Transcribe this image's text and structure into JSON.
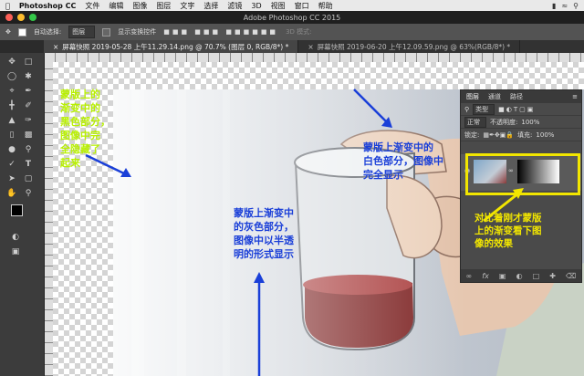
{
  "menubar": {
    "app": "Photoshop CC",
    "items": [
      "文件",
      "编辑",
      "图像",
      "图层",
      "文字",
      "选择",
      "滤镜",
      "3D",
      "视图",
      "窗口",
      "帮助"
    ]
  },
  "window": {
    "title": "Adobe Photoshop CC 2015"
  },
  "options": {
    "auto_select_label": "自动选择:",
    "auto_select_value": "图层",
    "transform_label": "显示变换控件",
    "mode_3d": "3D 模式:"
  },
  "tabs": [
    {
      "label": "屏幕快照 2019-05-28 上午11.29.14.png @ 70.7% (图层 0, RGB/8*) *"
    },
    {
      "label": "屏幕快照 2019-06-20 上午12.09.59.png @ 63%(RGB/8*) *"
    }
  ],
  "layers_panel": {
    "tabs": [
      "图层",
      "通道",
      "路径"
    ],
    "kind_label": "类型",
    "blend_mode": "正常",
    "opacity_label": "不透明度:",
    "opacity_value": "100%",
    "lock_label": "锁定:",
    "fill_label": "填充:",
    "fill_value": "100%"
  },
  "annotations": {
    "black_part": [
      "蒙版上的",
      "渐变中的",
      "黑色部分，",
      "图像中完",
      "全隐藏了",
      "起来"
    ],
    "white_part": [
      "蒙版上渐变中的",
      "白色部分，图像中",
      "完全显示"
    ],
    "gray_part": [
      "蒙版上渐变中",
      "的灰色部分，",
      "图像中以半透",
      "明的形式显示"
    ],
    "compare": [
      "对比着刚才蒙版",
      "上的渐变看下图",
      "像的效果"
    ]
  },
  "colors": {
    "annotation_green": "#b8f000",
    "annotation_blue": "#1a3fd8",
    "annotation_yellow": "#f2e600",
    "highlight_frame": "#f2e600"
  }
}
